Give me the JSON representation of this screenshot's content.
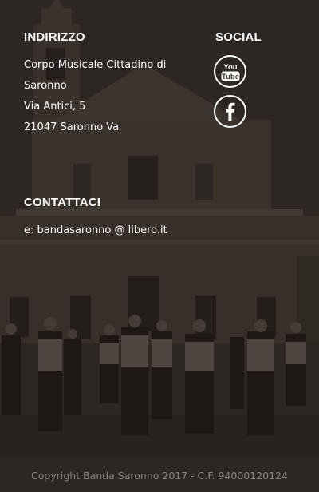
{
  "address": {
    "heading": "INDIRIZZO",
    "line1": "Corpo Musicale Cittadino di",
    "line2": "Saronno",
    "line3": "Via Antici, 5",
    "line4": "21047 Saronno Va"
  },
  "social": {
    "heading": "SOCIAL",
    "youtube_icon": "youtube-icon",
    "youtube_text_top": "You",
    "youtube_text_bottom": "Tube",
    "facebook_icon": "facebook-icon",
    "facebook_glyph": "f"
  },
  "contact": {
    "heading": "CONTATTACI",
    "email_line": "e: bandasaronno @ libero.it"
  },
  "footer": {
    "copyright": "Copyright Banda Saronno 2017 - C.F. 94000120124"
  },
  "colors": {
    "text": "#ffffff",
    "footer_bg": "#2b2724",
    "footer_text": "#8a8580"
  }
}
